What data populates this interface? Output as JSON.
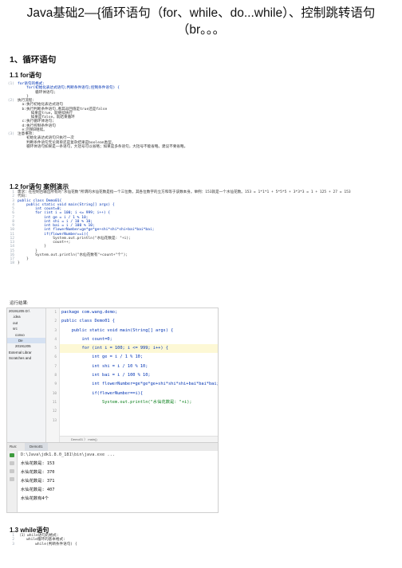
{
  "title": "Java基础2—{循环语句（for、while、do...while）、控制跳转语句（br。。。",
  "section1": "1、循环语句",
  "sub_for": "1.1 for语句",
  "sub_demo": "1.2 for语句 案例演示",
  "sub_while": "1.3 while语句",
  "run_result_label": "运行结果:",
  "code_for_syntax": [
    {
      "n": "(1)",
      "t": "for语句的格式:"
    },
    {
      "n": "",
      "t": "    for(初始化表达式语句;判断条件语句;控制条件语句) {"
    },
    {
      "n": "",
      "t": "        循环体语句;"
    },
    {
      "n": "",
      "t": "    }"
    },
    {
      "n": "(2)",
      "t": "执行流程:"
    },
    {
      "n": "",
      "t": "  a:执行初始化表达式语句"
    },
    {
      "n": "",
      "t": "  b:执行判断条件语句,看其返回值是true还是false"
    },
    {
      "n": "",
      "t": "      如果是true，就继续执行"
    },
    {
      "n": "",
      "t": "      如果是false，就结束循环"
    },
    {
      "n": "",
      "t": "  c:执行循环体语句;"
    },
    {
      "n": "",
      "t": "  d:执行控制条件语句"
    },
    {
      "n": "",
      "t": "  e:回到B继续。"
    },
    {
      "n": "(3)",
      "t": "注意事项:"
    },
    {
      "n": "",
      "t": "    初始化表达式语句只执行一次"
    },
    {
      "n": "",
      "t": "    判断条件语句无论简单还是复杂结果是boolean类型。"
    },
    {
      "n": "",
      "t": "    循环体语句如果是一条语句，大括号可以省略；如果是多条语句，大括号不能省略。建议不要省略。"
    }
  ],
  "code_demo": [
    {
      "n": "1",
      "t": "需求：在控制台输出所有的\"水仙花数\"所谓的水仙花数是指一个三位数，其各位数字的立方和等于该数本身。举例：153就是一个水仙花数。153 = 1*1*1 + 5*5*5 + 3*3*3 = 1 + 125 + 27 = 153"
    },
    {
      "n": "2",
      "t": "代码:"
    },
    {
      "n": "3",
      "t": "public class Demo01{"
    },
    {
      "n": "4",
      "t": "    public static void main(String[] args) {"
    },
    {
      "n": "5",
      "t": "        int count=0;"
    },
    {
      "n": "6",
      "t": "        for (int i = 100; i <= 999; i++) {"
    },
    {
      "n": "7",
      "t": "            int ge = i / 1 % 10;"
    },
    {
      "n": "8",
      "t": "            int shi = i / 10 % 10;"
    },
    {
      "n": "9",
      "t": "            int bai = i / 100 % 10;"
    },
    {
      "n": "10",
      "t": "            int flowerNumber=ge*ge*ge+shi*shi*shi+bai*bai*bai;"
    },
    {
      "n": "11",
      "t": "            if(flowerNumber==i){"
    },
    {
      "n": "12",
      "t": "                System.out.println(\"水仙花数是: \"+i);"
    },
    {
      "n": "13",
      "t": "                count++;"
    },
    {
      "n": "14",
      "t": "            }"
    },
    {
      "n": "15",
      "t": "        }"
    },
    {
      "n": "16",
      "t": "        System.out.println(\"水仙花数有\"+count+\"个\");"
    },
    {
      "n": "17",
      "t": "    }"
    },
    {
      "n": "18",
      "t": "}"
    }
  ],
  "ide": {
    "project_items": [
      "20191205  D:\\",
      ".idea",
      "out",
      "src",
      "convo",
      "De",
      "20191205",
      "External Librar",
      "Scratches and"
    ],
    "gutter": [
      "1",
      "2",
      "3",
      "4",
      "5",
      "6",
      "7",
      "8",
      "9",
      "10",
      "11",
      "12",
      "13"
    ],
    "editor_lines": [
      "package com.wang.demo;",
      "",
      "public class Demo01 {",
      "    public static void main(String[] args) {",
      "        int count=0;",
      "        for (int i = 100; i <= 999; i++) {",
      "            int ge = i / 1 % 10;",
      "            int shi = i / 10 % 10;",
      "            int bai = i / 100 % 10;",
      "            int flowerNumber=ge*ge*ge+shi*shi*shi+bai*bai*bai;",
      "            if(flowerNumber==i){",
      "                System.out.println(\"水仙花数是: \"+i);",
      ""
    ],
    "crumb": "Demo01  〉  main()",
    "run_label": "Run:",
    "run_tab": "Demo01",
    "console_lines": [
      "D:\\Java\\jdk1.8.0_181\\bin\\java.exe ...",
      "水仙花数是: 153",
      "水仙花数是: 370",
      "水仙花数是: 371",
      "水仙花数是: 407",
      "水仙花数有4个"
    ]
  },
  "code_while": [
    {
      "n": "1",
      "t": "（1）while语句的格式:"
    },
    {
      "n": "2",
      "t": "    while循环的基本格式:"
    },
    {
      "n": "3",
      "t": "        while(判断条件语句) {"
    }
  ],
  "colors": {
    "keyword": "#0033b3",
    "string": "#067d17",
    "highlight_line": "#fdf8d5",
    "ide_bg": "#f2f2f2"
  }
}
